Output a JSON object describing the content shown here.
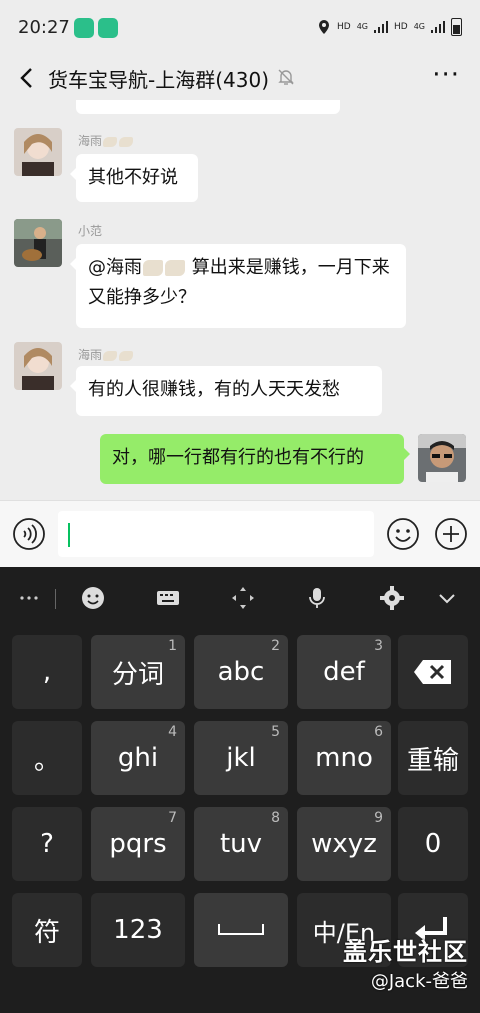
{
  "status_bar": {
    "time": "20:27",
    "net_left": "HD",
    "net_left_type": "4G",
    "net_right": "HD",
    "net_right_type": "4G"
  },
  "header": {
    "title": "货车宝导航-上海群(430)",
    "back_icon": "back-arrow-icon",
    "mute_icon": "bell-off-icon",
    "more_label": "···"
  },
  "messages": [
    {
      "sender": "海雨",
      "text": "其他不好说",
      "side": "left"
    },
    {
      "sender": "小范",
      "text_before": "@海雨",
      "text_after": " 算出来是赚钱，一月下来又能挣多少？",
      "side": "left"
    },
    {
      "sender": "海雨",
      "text": "有的人很赚钱，有的人天天发愁",
      "side": "left"
    },
    {
      "text": "对，哪一行都有行的也有不行的",
      "side": "right"
    }
  ],
  "input_bar": {
    "voice_icon": "voice-icon",
    "emoji_icon": "emoji-icon",
    "plus_icon": "plus-icon"
  },
  "keyboard": {
    "toolbar": [
      "more-icon",
      "emoji-icon",
      "keyboard-icon",
      "cursor-move-icon",
      "mic-icon",
      "gear-icon",
      "chevron-down-icon"
    ],
    "rows": [
      [
        {
          "label": ",",
          "num": ""
        },
        {
          "label": "分词",
          "num": "1"
        },
        {
          "label": "abc",
          "num": "2"
        },
        {
          "label": "def",
          "num": "3"
        },
        {
          "label": "⌫",
          "num": ""
        }
      ],
      [
        {
          "label": "。",
          "num": ""
        },
        {
          "label": "ghi",
          "num": "4"
        },
        {
          "label": "jkl",
          "num": "5"
        },
        {
          "label": "mno",
          "num": "6"
        },
        {
          "label": "重输",
          "num": ""
        }
      ],
      [
        {
          "label": "?",
          "num": ""
        },
        {
          "label": "pqrs",
          "num": "7"
        },
        {
          "label": "tuv",
          "num": "8"
        },
        {
          "label": "wxyz",
          "num": "9"
        },
        {
          "label": "0",
          "num": ""
        }
      ],
      [
        {
          "label": "符",
          "num": ""
        },
        {
          "label": "123",
          "num": ""
        },
        {
          "label": "␣",
          "num": ""
        },
        {
          "label": "中/En",
          "num": ""
        },
        {
          "label": "↵",
          "num": ""
        }
      ]
    ]
  },
  "watermark": {
    "line1": "盖乐世社区",
    "line2": "@Jack-爸爸"
  },
  "colors": {
    "accent": "#07c160",
    "my_bubble": "#95ec69",
    "chat_bg": "#ededed",
    "keyboard_bg": "#1e1e1e"
  }
}
